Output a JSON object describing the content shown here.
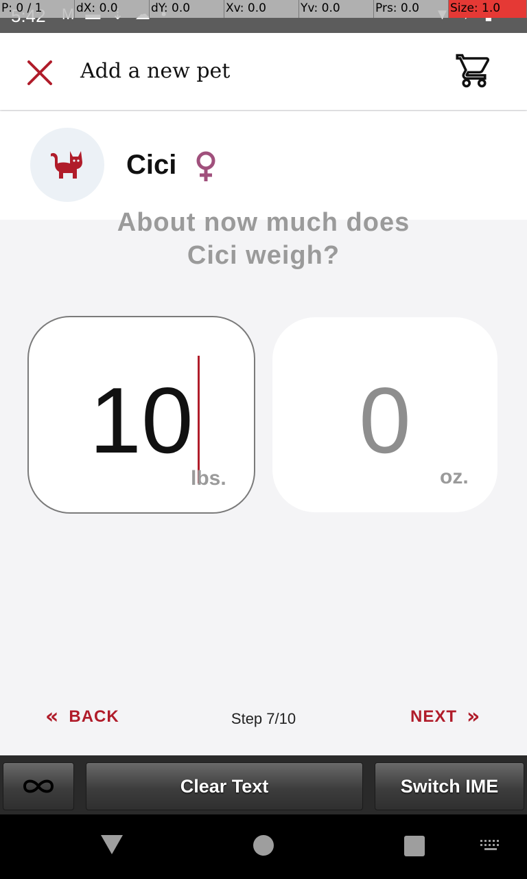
{
  "status_bar": {
    "time": "5:42"
  },
  "pointer_overlay": {
    "p": "P: 0 / 1",
    "dx": "dX: 0.0",
    "dy": "dY: 0.0",
    "xv": "Xv: 0.0",
    "yv": "Yv: 0.0",
    "prs": "Prs: 0.0",
    "size": "Size: 1.0"
  },
  "app_bar": {
    "title": "Add a new pet",
    "close_icon": "close-icon",
    "cart_icon": "cart-icon"
  },
  "pet": {
    "name": "Cici",
    "avatar_icon": "cat-icon",
    "gender_icon": "female-icon"
  },
  "question": {
    "line1": "About now much does",
    "line2": "Cici weigh?"
  },
  "weight": {
    "lbs_value": "10",
    "lbs_unit": "lbs.",
    "oz_value": "0",
    "oz_unit": "oz."
  },
  "step_nav": {
    "back_label": "BACK",
    "next_label": "NEXT",
    "step_label": "Step 7/10"
  },
  "keyboard_toolbar": {
    "clear_label": "Clear Text",
    "switch_label": "Switch IME"
  },
  "colors": {
    "accent": "#b01c2a",
    "pet_gender": "#a0507c",
    "background": "#f4f4f6"
  }
}
